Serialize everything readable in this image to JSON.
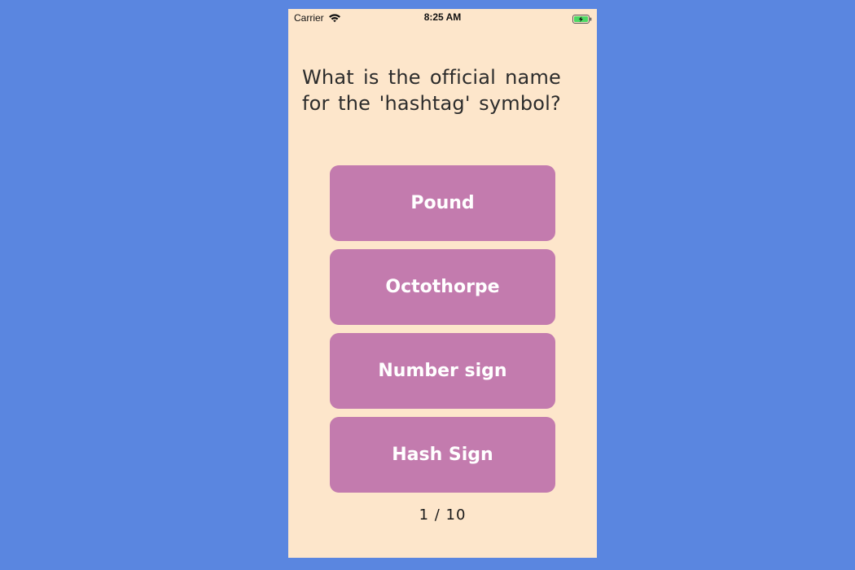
{
  "status_bar": {
    "carrier": "Carrier",
    "time": "8:25 AM",
    "wifi_icon": "wifi-icon",
    "battery_icon": "battery-charging-icon"
  },
  "question": {
    "text": "What is the official name for the 'hashtag' symbol?"
  },
  "answers": [
    {
      "label": "Pound"
    },
    {
      "label": "Octothorpe"
    },
    {
      "label": "Number sign"
    },
    {
      "label": "Hash Sign"
    }
  ],
  "progress": {
    "text": "1 / 10",
    "current": 1,
    "total": 10
  },
  "colors": {
    "background": "#5a86e0",
    "screen": "#fde6cb",
    "answer_button": "#c37bae",
    "answer_text": "#ffffff",
    "battery_fill": "#4cd964"
  }
}
